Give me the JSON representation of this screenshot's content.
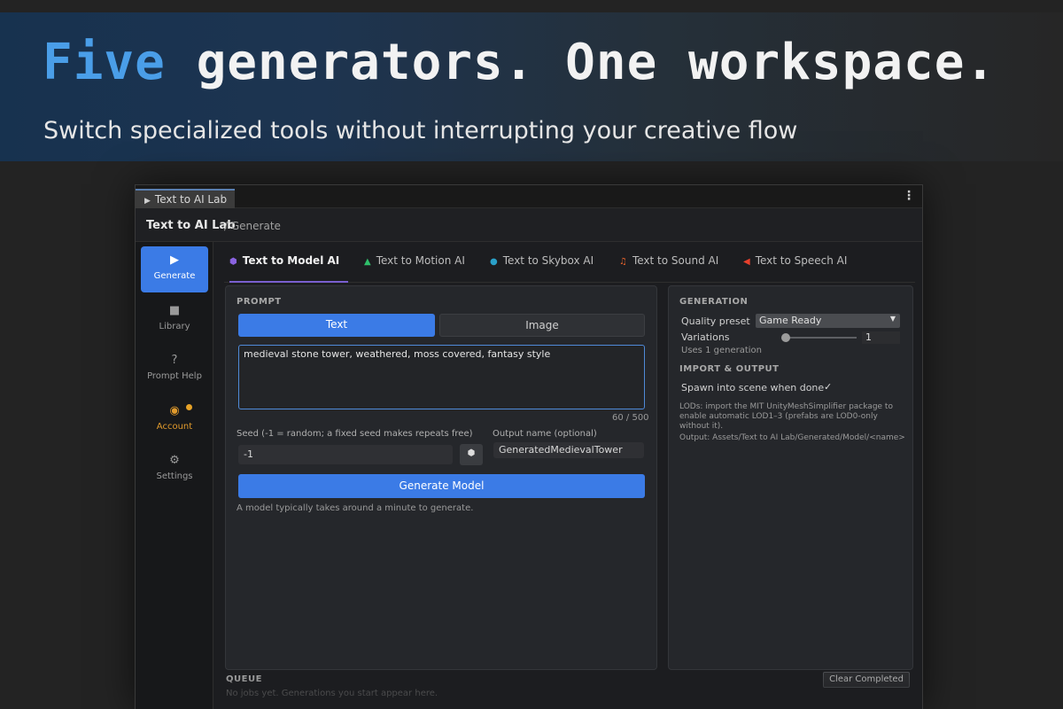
{
  "hero": {
    "title_accent": "Five",
    "title_rest": " generators. One workspace.",
    "subtitle": "Switch specialized tools without interrupting your creative flow"
  },
  "window": {
    "tab_label": "Text to AI Lab",
    "menu_icon": "kebab-menu-icon"
  },
  "header": {
    "app_name": "Text to AI Lab",
    "breadcrumb": "/ Generate"
  },
  "sidebar": {
    "items": [
      {
        "label": "Generate",
        "icon": "play-icon",
        "glyph": "▶"
      },
      {
        "label": "Library",
        "icon": "folder-icon",
        "glyph": "■"
      },
      {
        "label": "Prompt Help",
        "icon": "help-icon",
        "glyph": "?"
      },
      {
        "label": "Account",
        "icon": "eye-icon",
        "glyph": "◉"
      },
      {
        "label": "Settings",
        "icon": "gear-icon",
        "glyph": "⚙"
      }
    ],
    "active": "Generate",
    "account_dot_color": "#e6a227"
  },
  "generator_tabs": [
    {
      "label": "Text to Model AI",
      "glyph": "⬢",
      "color": "#8a63e0"
    },
    {
      "label": "Text to Motion AI",
      "glyph": "▲",
      "color": "#2fbf6a"
    },
    {
      "label": "Text to Skybox AI",
      "glyph": "●",
      "color": "#2aa0c8"
    },
    {
      "label": "Text to Sound AI",
      "glyph": "♫",
      "color": "#e8632c"
    },
    {
      "label": "Text to Speech AI",
      "glyph": "◀",
      "color": "#e8402c"
    }
  ],
  "prompt": {
    "section_label": "PROMPT",
    "mode_text": "Text",
    "mode_image": "Image",
    "value": "medieval stone tower, weathered, moss covered, fantasy style",
    "char_count": "60 / 500",
    "seed_label": "Seed (-1 = random; a fixed seed makes repeats free)",
    "seed_value": "-1",
    "dice_icon": "dice-icon",
    "output_label": "Output name (optional)",
    "output_value": "GeneratedMedievalTower",
    "generate_button": "Generate Model",
    "hint": "A model typically takes around a minute to generate."
  },
  "generation": {
    "section_label": "GENERATION",
    "quality_label": "Quality preset",
    "quality_value": "Game Ready",
    "variations_label": "Variations",
    "variations_value": "1",
    "variations_level": 0,
    "uses_text": "Uses 1 generation",
    "import_label": "IMPORT & OUTPUT",
    "spawn_label": "Spawn into scene when done",
    "spawn_checked": "✓",
    "lods_text_1": "LODs: import the MIT UnityMeshSimplifier package to",
    "lods_text_2": "enable automatic LOD1–3 (prefabs are LOD0-only",
    "lods_text_3": "without it).",
    "output_path": "Output: Assets/Text to AI Lab/Generated/Model/<name>"
  },
  "queue": {
    "label": "QUEUE",
    "empty_text": "No jobs yet. Generations you start appear here.",
    "clear_button": "Clear Completed"
  }
}
